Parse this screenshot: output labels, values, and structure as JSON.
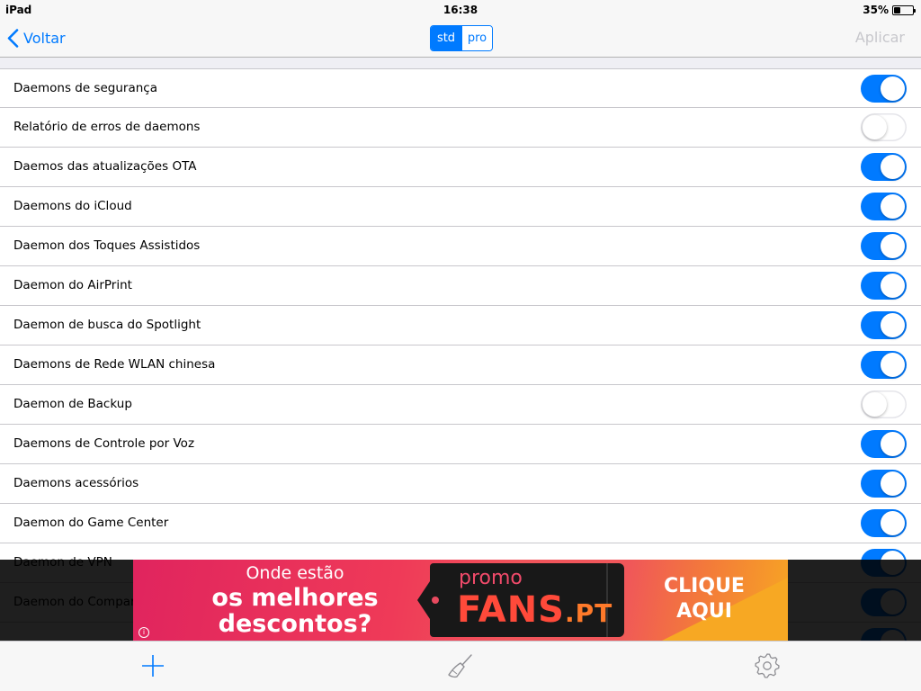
{
  "status_bar": {
    "device": "iPad",
    "time": "16:38",
    "battery_level": "35%",
    "battery_fraction": 0.35
  },
  "nav": {
    "back_label": "Voltar",
    "segments": [
      "std",
      "pro"
    ],
    "active_segment": "std",
    "apply_label": "Aplicar"
  },
  "colors": {
    "accent": "#007aff",
    "toggle_off": "#ffffff",
    "disabled_text": "#c7c7cc"
  },
  "rows": [
    {
      "label": "Daemons de segurança",
      "on": true
    },
    {
      "label": "Relatório de erros de daemons",
      "on": false
    },
    {
      "label": "Daemos das atualizações OTA",
      "on": true
    },
    {
      "label": "Daemons do iCloud",
      "on": true
    },
    {
      "label": "Daemon dos Toques Assistidos",
      "on": true
    },
    {
      "label": "Daemon do AirPrint",
      "on": true
    },
    {
      "label": "Daemon de busca do Spotlight",
      "on": true
    },
    {
      "label": "Daemons de Rede WLAN chinesa",
      "on": true
    },
    {
      "label": "Daemon de Backup",
      "on": false
    },
    {
      "label": "Daemons de Controle por Voz",
      "on": true
    },
    {
      "label": "Daemons acessórios",
      "on": true
    },
    {
      "label": "Daemon do Game Center",
      "on": true
    },
    {
      "label": "Daemon de VPN",
      "on": true
    },
    {
      "label": "Daemon do Compar",
      "on": true
    },
    {
      "label": "",
      "on": true
    }
  ],
  "ad": {
    "line1": "Onde estão",
    "line2": "os melhores",
    "line3": "descontos?",
    "tag_promo": "promo",
    "tag_brand": "FANS",
    "tag_brand_suffix": ".PT",
    "cta_line1": "CLIQUE",
    "cta_line2": "AQUI",
    "info": "i"
  },
  "tab_bar": {
    "icons": [
      "plus-icon",
      "broom-icon",
      "gear-icon"
    ]
  }
}
